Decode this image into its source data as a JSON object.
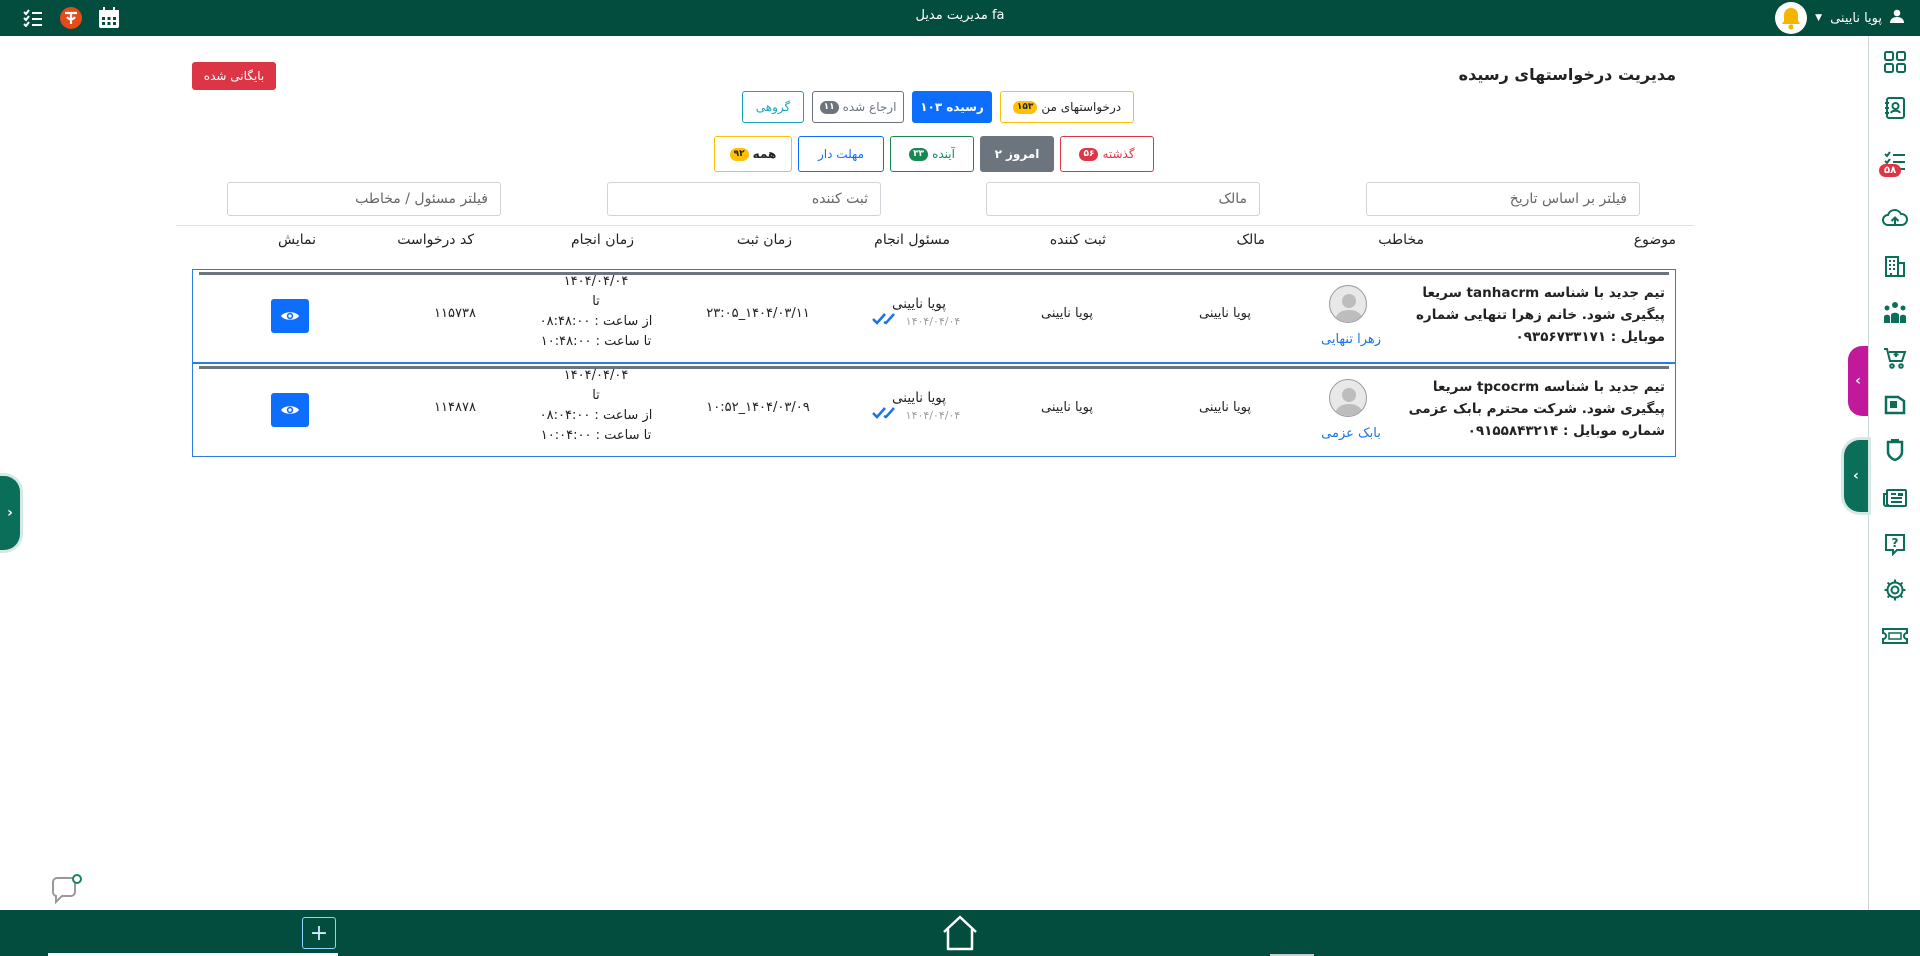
{
  "topbar": {
    "title": "مدیریت مدیل fa",
    "user_name": "پویا نایینی",
    "icons": [
      "list-check-icon",
      "app-logo-icon",
      "calendar-icon",
      "bell-icon",
      "user-icon"
    ]
  },
  "page": {
    "title": "مدیریت درخواستهای رسیده",
    "archived_label": "بایگانی شده"
  },
  "tabs_row1": [
    {
      "label": "درخواستهای من",
      "count": "۱۵۳",
      "style": "warning"
    },
    {
      "label": "رسیده",
      "count": "۱۰۳",
      "style": "primary-active"
    },
    {
      "label": "ارجاع شده",
      "count": "۱۱",
      "style": "secondary"
    },
    {
      "label": "گروهی",
      "count": "",
      "style": "info"
    }
  ],
  "tabs_row2": [
    {
      "label": "گذشته",
      "count": "۵۶",
      "style": "danger"
    },
    {
      "label": "امروز",
      "count": "۲",
      "style": "secondary-active"
    },
    {
      "label": "آینده",
      "count": "۳۳",
      "style": "success"
    },
    {
      "label": "مهلت دار",
      "count": "",
      "style": "primary"
    },
    {
      "label": "همه",
      "count": "۹۲",
      "style": "warning"
    }
  ],
  "filters": {
    "date_placeholder": "فیلتر بر اساس تاریخ",
    "owner_placeholder": "مالک",
    "creator_placeholder": "ثبت کننده",
    "responsible_placeholder": "فیلتر مسئول / مخاطب"
  },
  "table": {
    "headers": {
      "subject": "موضوع",
      "audience": "مخاطب",
      "owner": "مالک",
      "creator": "ثبت کننده",
      "responsible": "مسئول انجام",
      "created_at": "زمان ثبت",
      "due_time": "زمان انجام",
      "code": "کد درخواست",
      "view": "نمایش"
    },
    "rows": [
      {
        "subject_lines": [
          "تیم جدید با شناسه tanhacrm سریعا",
          "پیگیری شود. خانم زهرا تنهایی شماره",
          "موبایل : ۰۹۳۵۶۷۳۳۱۷۱"
        ],
        "audience": "زهرا تنهایی",
        "owner": "پویا نایینی",
        "creator": "پویا نایینی",
        "responsible": "پویا نایینی",
        "responsible_date": "۱۴۰۴/۰۴/۰۴",
        "created_at": "۱۴۰۴/۰۳/۱۱_۲۳:۰۵",
        "due_date": "۱۴۰۴/۰۴/۰۴",
        "due_to": "تا",
        "due_from_time": "از ساعت : ۰۸:۴۸:۰۰",
        "due_to_time": "تا ساعت : ۱۰:۴۸:۰۰",
        "code": "۱۱۵۷۳۸"
      },
      {
        "subject_lines": [
          "تیم جدید با شناسه tpcocrm سریعا",
          "پیگیری شود. شرکت محترم بابک عزمی",
          "شماره موبایل : ۰۹۱۵۵۸۴۳۲۱۴"
        ],
        "audience": "بابک عزمی",
        "owner": "پویا نایینی",
        "creator": "پویا نایینی",
        "responsible": "پویا نایینی",
        "responsible_date": "۱۴۰۴/۰۴/۰۴",
        "created_at": "۱۴۰۴/۰۳/۰۹_۱۰:۵۲",
        "due_date": "۱۴۰۴/۰۴/۰۴",
        "due_to": "تا",
        "due_from_time": "از ساعت : ۰۸:۰۴:۰۰",
        "due_to_time": "تا ساعت : ۱۰:۰۴:۰۰",
        "code": "۱۱۴۸۷۸"
      }
    ]
  },
  "sidebar": {
    "badge": "۵۸",
    "icons": [
      "dashboard-grid-icon",
      "contacts-book-icon",
      "task-list-icon",
      "cloud-upload-icon",
      "building-icon",
      "team-icon",
      "cart-icon",
      "product-box-icon",
      "shield-icon",
      "news-icon",
      "help-icon",
      "settings-icon",
      "ticket-icon"
    ]
  },
  "colors": {
    "topbar": "#034d3f",
    "primary": "#0d6efd",
    "danger": "#dc3545",
    "success": "#198754",
    "warning": "#ffc107",
    "secondary": "#6c757d",
    "info": "#0dcaf0"
  }
}
